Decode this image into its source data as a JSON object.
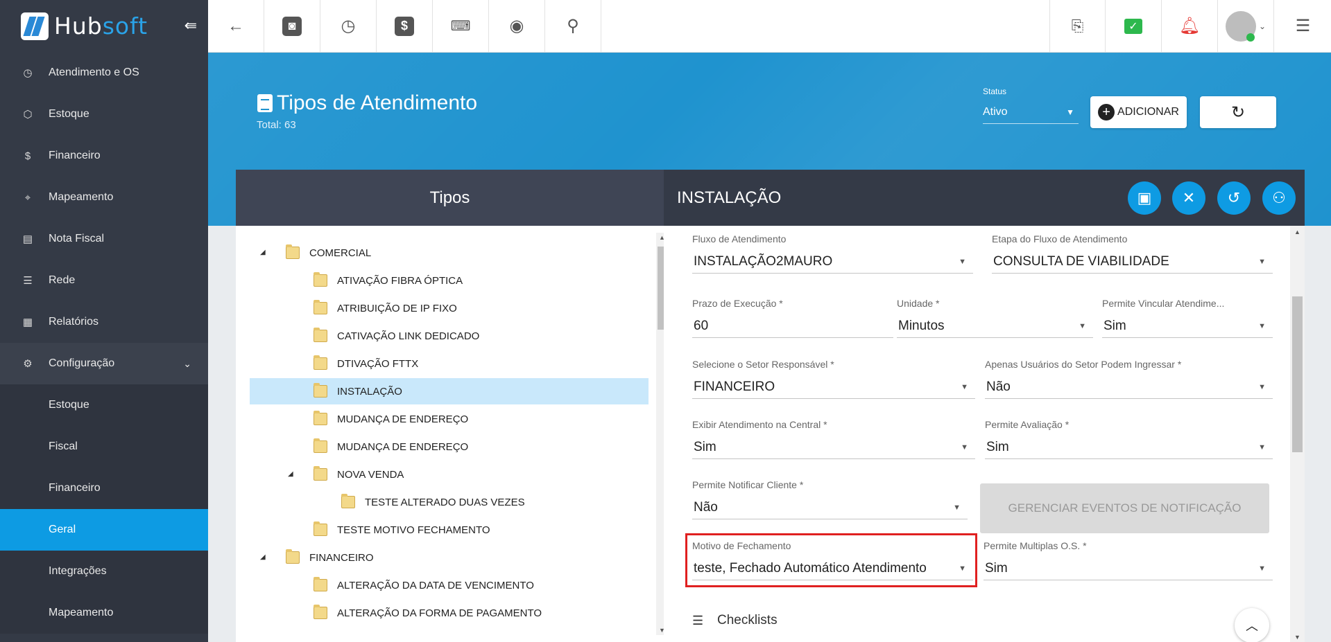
{
  "app": {
    "logo_part1": "Hub",
    "logo_part2": "soft"
  },
  "sidebar": {
    "items": [
      {
        "label": "Atendimento e OS",
        "icon": "calendar-clock-icon"
      },
      {
        "label": "Estoque",
        "icon": "box-icon"
      },
      {
        "label": "Financeiro",
        "icon": "money-icon"
      },
      {
        "label": "Mapeamento",
        "icon": "map-pin-icon"
      },
      {
        "label": "Nota Fiscal",
        "icon": "receipt-icon"
      },
      {
        "label": "Rede",
        "icon": "server-icon"
      },
      {
        "label": "Relatórios",
        "icon": "report-icon"
      },
      {
        "label": "Configuração",
        "icon": "gear-icon"
      }
    ],
    "sub_items": [
      {
        "label": "Estoque"
      },
      {
        "label": "Fiscal"
      },
      {
        "label": "Financeiro"
      },
      {
        "label": "Geral"
      },
      {
        "label": "Integrações"
      },
      {
        "label": "Mapeamento"
      }
    ],
    "active_sub": "Geral"
  },
  "header": {
    "title": "Tipos de Atendimento",
    "total": "Total: 63",
    "status_label": "Status",
    "status_value": "Ativo",
    "add_label": "ADICIONAR"
  },
  "panel": {
    "left_title": "Tipos",
    "right_title": "INSTALAÇÃO"
  },
  "tree": [
    {
      "label": "COMERCIAL",
      "level": 0,
      "expanded": true
    },
    {
      "label": "ATIVAÇÃO FIBRA ÓPTICA",
      "level": 1
    },
    {
      "label": "ATRIBUIÇÃO DE IP FIXO",
      "level": 1
    },
    {
      "label": "CATIVAÇÃO LINK DEDICADO",
      "level": 1
    },
    {
      "label": "DTIVAÇÃO FTTX",
      "level": 1
    },
    {
      "label": "INSTALAÇÃO",
      "level": 1,
      "selected": true
    },
    {
      "label": "MUDANÇA DE ENDEREÇO",
      "level": 1
    },
    {
      "label": "MUDANÇA DE ENDEREÇO",
      "level": 1
    },
    {
      "label": "NOVA VENDA",
      "level": 1,
      "expanded": true
    },
    {
      "label": "TESTE ALTERADO DUAS VEZES",
      "level": 2
    },
    {
      "label": "TESTE MOTIVO FECHAMENTO",
      "level": 1
    },
    {
      "label": "FINANCEIRO",
      "level": 0,
      "expanded": true
    },
    {
      "label": "ALTERAÇÃO DA DATA DE VENCIMENTO",
      "level": 1
    },
    {
      "label": "ALTERAÇÃO DA FORMA DE PAGAMENTO",
      "level": 1
    }
  ],
  "form": {
    "fluxo": {
      "label": "Fluxo de Atendimento",
      "value": "INSTALAÇÃO2MAURO"
    },
    "etapa": {
      "label": "Etapa do Fluxo de Atendimento",
      "value": "CONSULTA DE VIABILIDADE"
    },
    "prazo": {
      "label": "Prazo de Execução *",
      "value": "60"
    },
    "unidade": {
      "label": "Unidade *",
      "value": "Minutos"
    },
    "vincular": {
      "label": "Permite Vincular Atendime...",
      "value": "Sim"
    },
    "setor": {
      "label": "Selecione o Setor Responsável *",
      "value": "FINANCEIRO"
    },
    "apenas": {
      "label": "Apenas Usuários do Setor Podem Ingressar *",
      "value": "Não"
    },
    "exibir": {
      "label": "Exibir Atendimento na Central *",
      "value": "Sim"
    },
    "avaliacao": {
      "label": "Permite Avaliação *",
      "value": "Sim"
    },
    "notificar": {
      "label": "Permite Notificar Cliente *",
      "value": "Não"
    },
    "gerenciar_label": "GERENCIAR EVENTOS DE NOTIFICAÇÃO",
    "motivo": {
      "label": "Motivo de Fechamento",
      "value": "teste, Fechado Automático Atendimento"
    },
    "multiplas": {
      "label": "Permite Multiplas O.S. *",
      "value": "Sim"
    },
    "checklists_label": "Checklists"
  },
  "colors": {
    "accent": "#0e9be3",
    "sidebar": "#343a46",
    "highlight": "#e02020"
  }
}
